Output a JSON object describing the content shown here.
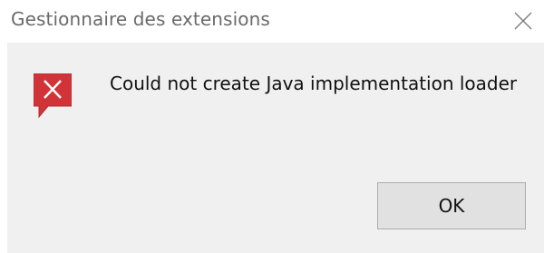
{
  "window": {
    "title": "Gestionnaire des extensions",
    "close_icon": "close-icon"
  },
  "dialog": {
    "icon": "error-icon",
    "icon_color": "#d13438",
    "message": "Could not create Java implementation loader",
    "ok_label": "OK"
  }
}
